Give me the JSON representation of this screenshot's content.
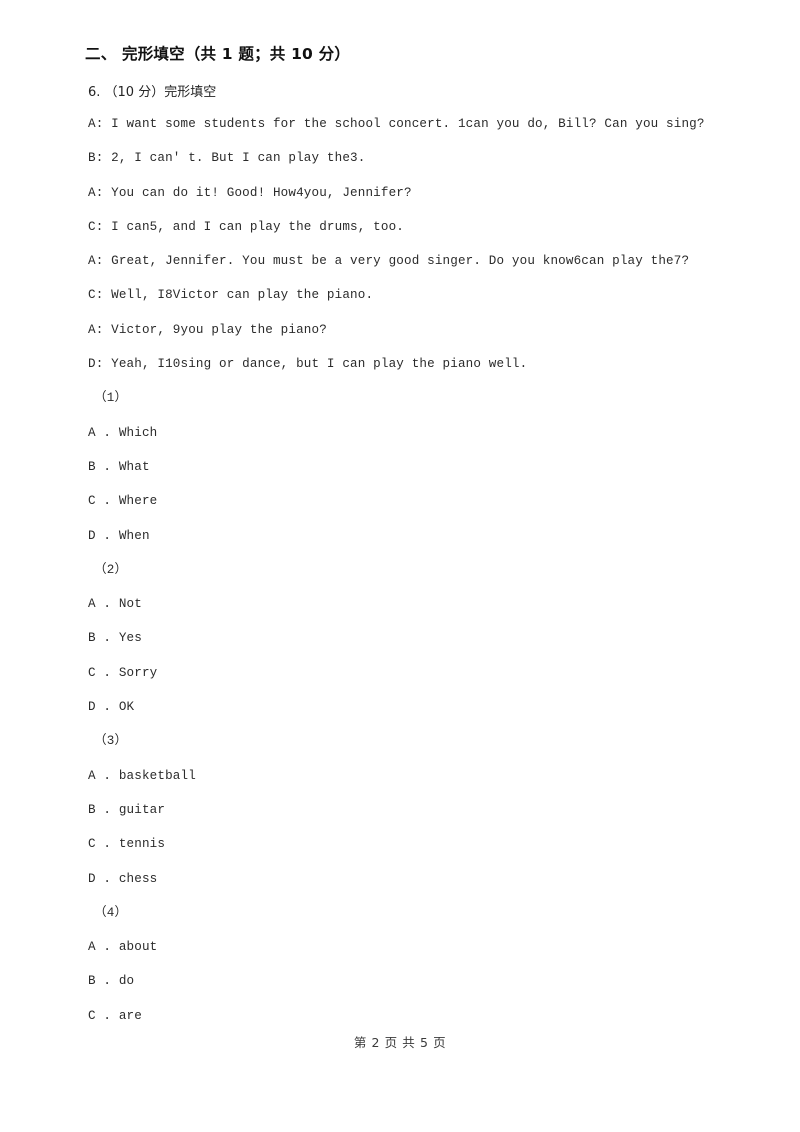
{
  "document": {
    "background_color": "#ffffff",
    "text_color": "#2b2b2b"
  },
  "section": {
    "heading": "二、 完形填空（共 1 题；共 10 分）"
  },
  "question": {
    "stem": "6. （10 分）完形填空",
    "dialogue": [
      "A: I want some students for the school concert. 1can you do, Bill? Can you sing?",
      "B: 2, I can' t. But I can play the3.",
      "A: You can do it! Good! How4you, Jennifer?",
      "C: I can5, and I can play the drums, too.",
      "A: Great, Jennifer. You must be a very good singer. Do you know6can play the7?",
      "C: Well, I8Victor can play the piano.",
      "A: Victor, 9you play the piano?",
      "D: Yeah, I10sing or dance, but I can play the piano well."
    ],
    "subquestions": [
      {
        "label": "（1）",
        "options": [
          "A . Which",
          "B . What",
          "C . Where",
          "D . When"
        ]
      },
      {
        "label": "（2）",
        "options": [
          "A . Not",
          "B . Yes",
          "C . Sorry",
          "D . OK"
        ]
      },
      {
        "label": "（3）",
        "options": [
          "A . basketball",
          "B . guitar",
          "C . tennis",
          "D . chess"
        ]
      },
      {
        "label": "（4）",
        "options": [
          "A . about",
          "B . do",
          "C . are"
        ]
      }
    ]
  },
  "footer": {
    "page_indicator": "第 2 页 共 5 页"
  }
}
